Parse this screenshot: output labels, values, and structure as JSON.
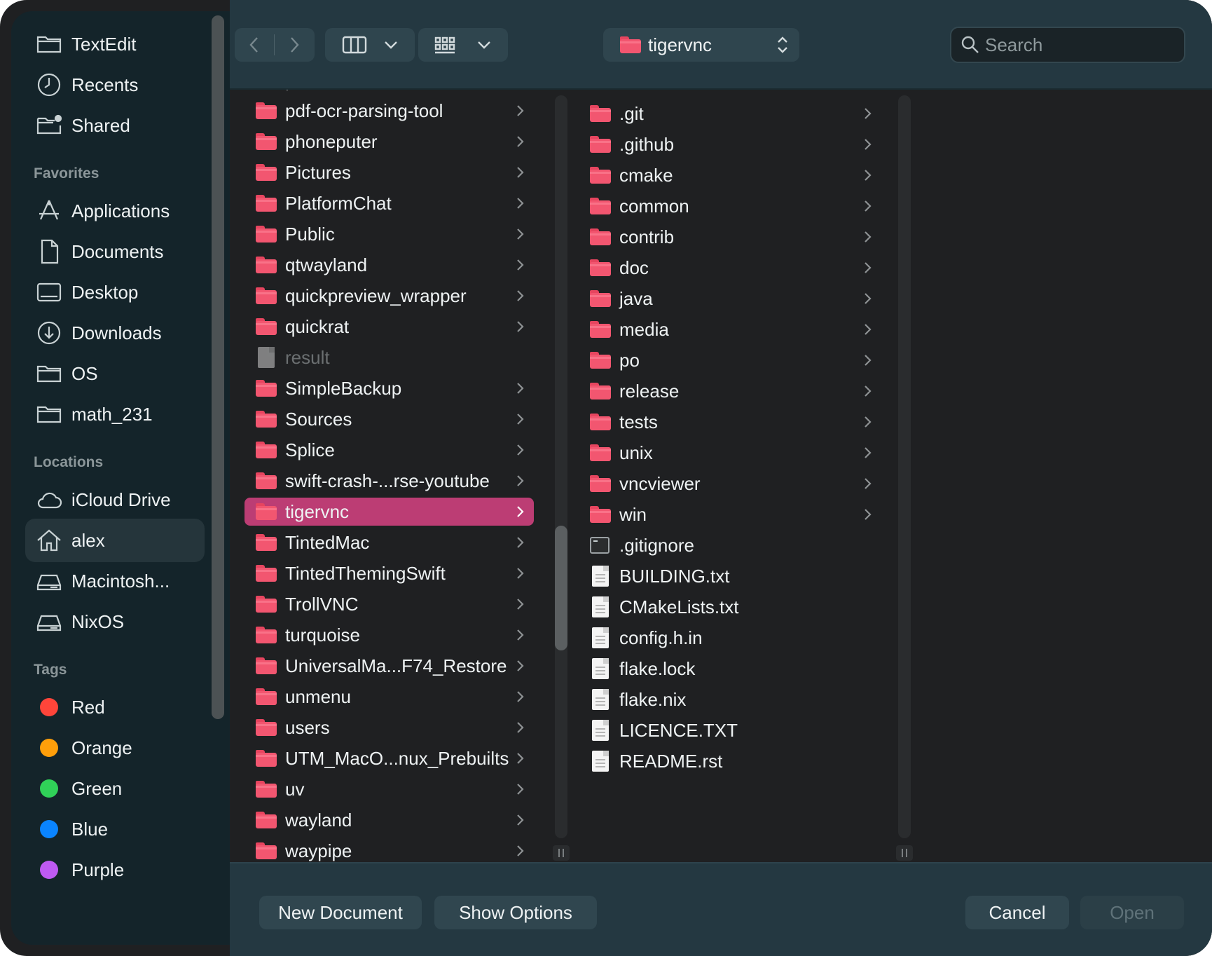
{
  "sidebar": {
    "top_items": [
      {
        "label": "TextEdit",
        "icon": "folder-icon"
      },
      {
        "label": "Recents",
        "icon": "clock-icon"
      },
      {
        "label": "Shared",
        "icon": "shared-folder-icon"
      }
    ],
    "favorites_header": "Favorites",
    "favorites": [
      {
        "label": "Applications",
        "icon": "applications-icon"
      },
      {
        "label": "Documents",
        "icon": "document-icon"
      },
      {
        "label": "Desktop",
        "icon": "desktop-icon"
      },
      {
        "label": "Downloads",
        "icon": "download-icon"
      },
      {
        "label": "OS",
        "icon": "folder-icon"
      },
      {
        "label": "math_231",
        "icon": "folder-icon"
      }
    ],
    "locations_header": "Locations",
    "locations": [
      {
        "label": "iCloud Drive",
        "icon": "cloud-icon"
      },
      {
        "label": "alex",
        "icon": "home-icon",
        "selected": true
      },
      {
        "label": "Macintosh...",
        "icon": "drive-icon"
      },
      {
        "label": "NixOS",
        "icon": "drive-icon"
      }
    ],
    "tags_header": "Tags",
    "tags": [
      {
        "label": "Red",
        "color": "#ff453a"
      },
      {
        "label": "Orange",
        "color": "#ff9f0a"
      },
      {
        "label": "Green",
        "color": "#30d158"
      },
      {
        "label": "Blue",
        "color": "#0a84ff"
      },
      {
        "label": "Purple",
        "color": "#bf5af2"
      }
    ]
  },
  "toolbar": {
    "back_icon": "chevron-left-icon",
    "forward_icon": "chevron-right-icon",
    "view_icon": "column-view-icon",
    "group_icon": "grid-icon",
    "path_folder": "tigervnc",
    "search_placeholder": "Search"
  },
  "column1": {
    "items": [
      {
        "name": "path",
        "type": "folder"
      },
      {
        "name": "pdf-ocr-parsing-tool",
        "type": "folder"
      },
      {
        "name": "phoneputer",
        "type": "folder"
      },
      {
        "name": "Pictures",
        "type": "folder"
      },
      {
        "name": "PlatformChat",
        "type": "folder"
      },
      {
        "name": "Public",
        "type": "folder"
      },
      {
        "name": "qtwayland",
        "type": "folder"
      },
      {
        "name": "quickpreview_wrapper",
        "type": "folder"
      },
      {
        "name": "quickrat",
        "type": "folder"
      },
      {
        "name": "result",
        "type": "alias",
        "disabled": true
      },
      {
        "name": "SimpleBackup",
        "type": "folder"
      },
      {
        "name": "Sources",
        "type": "folder"
      },
      {
        "name": "Splice",
        "type": "folder"
      },
      {
        "name": "swift-crash-...rse-youtube",
        "type": "folder"
      },
      {
        "name": "tigervnc",
        "type": "folder",
        "selected": true
      },
      {
        "name": "TintedMac",
        "type": "folder"
      },
      {
        "name": "TintedThemingSwift",
        "type": "folder"
      },
      {
        "name": "TrollVNC",
        "type": "folder"
      },
      {
        "name": "turquoise",
        "type": "folder"
      },
      {
        "name": "UniversalMa...F74_Restore",
        "type": "folder"
      },
      {
        "name": "unmenu",
        "type": "folder"
      },
      {
        "name": "users",
        "type": "folder"
      },
      {
        "name": "UTM_MacO...nux_Prebuilts",
        "type": "folder"
      },
      {
        "name": "uv",
        "type": "folder"
      },
      {
        "name": "wayland",
        "type": "folder"
      },
      {
        "name": "waypipe",
        "type": "folder"
      }
    ]
  },
  "column2": {
    "items": [
      {
        "name": ".git",
        "type": "folder"
      },
      {
        "name": ".github",
        "type": "folder"
      },
      {
        "name": "cmake",
        "type": "folder"
      },
      {
        "name": "common",
        "type": "folder"
      },
      {
        "name": "contrib",
        "type": "folder"
      },
      {
        "name": "doc",
        "type": "folder"
      },
      {
        "name": "java",
        "type": "folder"
      },
      {
        "name": "media",
        "type": "folder"
      },
      {
        "name": "po",
        "type": "folder"
      },
      {
        "name": "release",
        "type": "folder"
      },
      {
        "name": "tests",
        "type": "folder"
      },
      {
        "name": "unix",
        "type": "folder"
      },
      {
        "name": "vncviewer",
        "type": "folder"
      },
      {
        "name": "win",
        "type": "folder"
      },
      {
        "name": ".gitignore",
        "type": "terminal"
      },
      {
        "name": "BUILDING.txt",
        "type": "file"
      },
      {
        "name": "CMakeLists.txt",
        "type": "file"
      },
      {
        "name": "config.h.in",
        "type": "file"
      },
      {
        "name": "flake.lock",
        "type": "file"
      },
      {
        "name": "flake.nix",
        "type": "file"
      },
      {
        "name": "LICENCE.TXT",
        "type": "file"
      },
      {
        "name": "README.rst",
        "type": "file"
      }
    ]
  },
  "footer": {
    "new_document": "New Document",
    "show_options": "Show Options",
    "cancel": "Cancel",
    "open": "Open"
  }
}
